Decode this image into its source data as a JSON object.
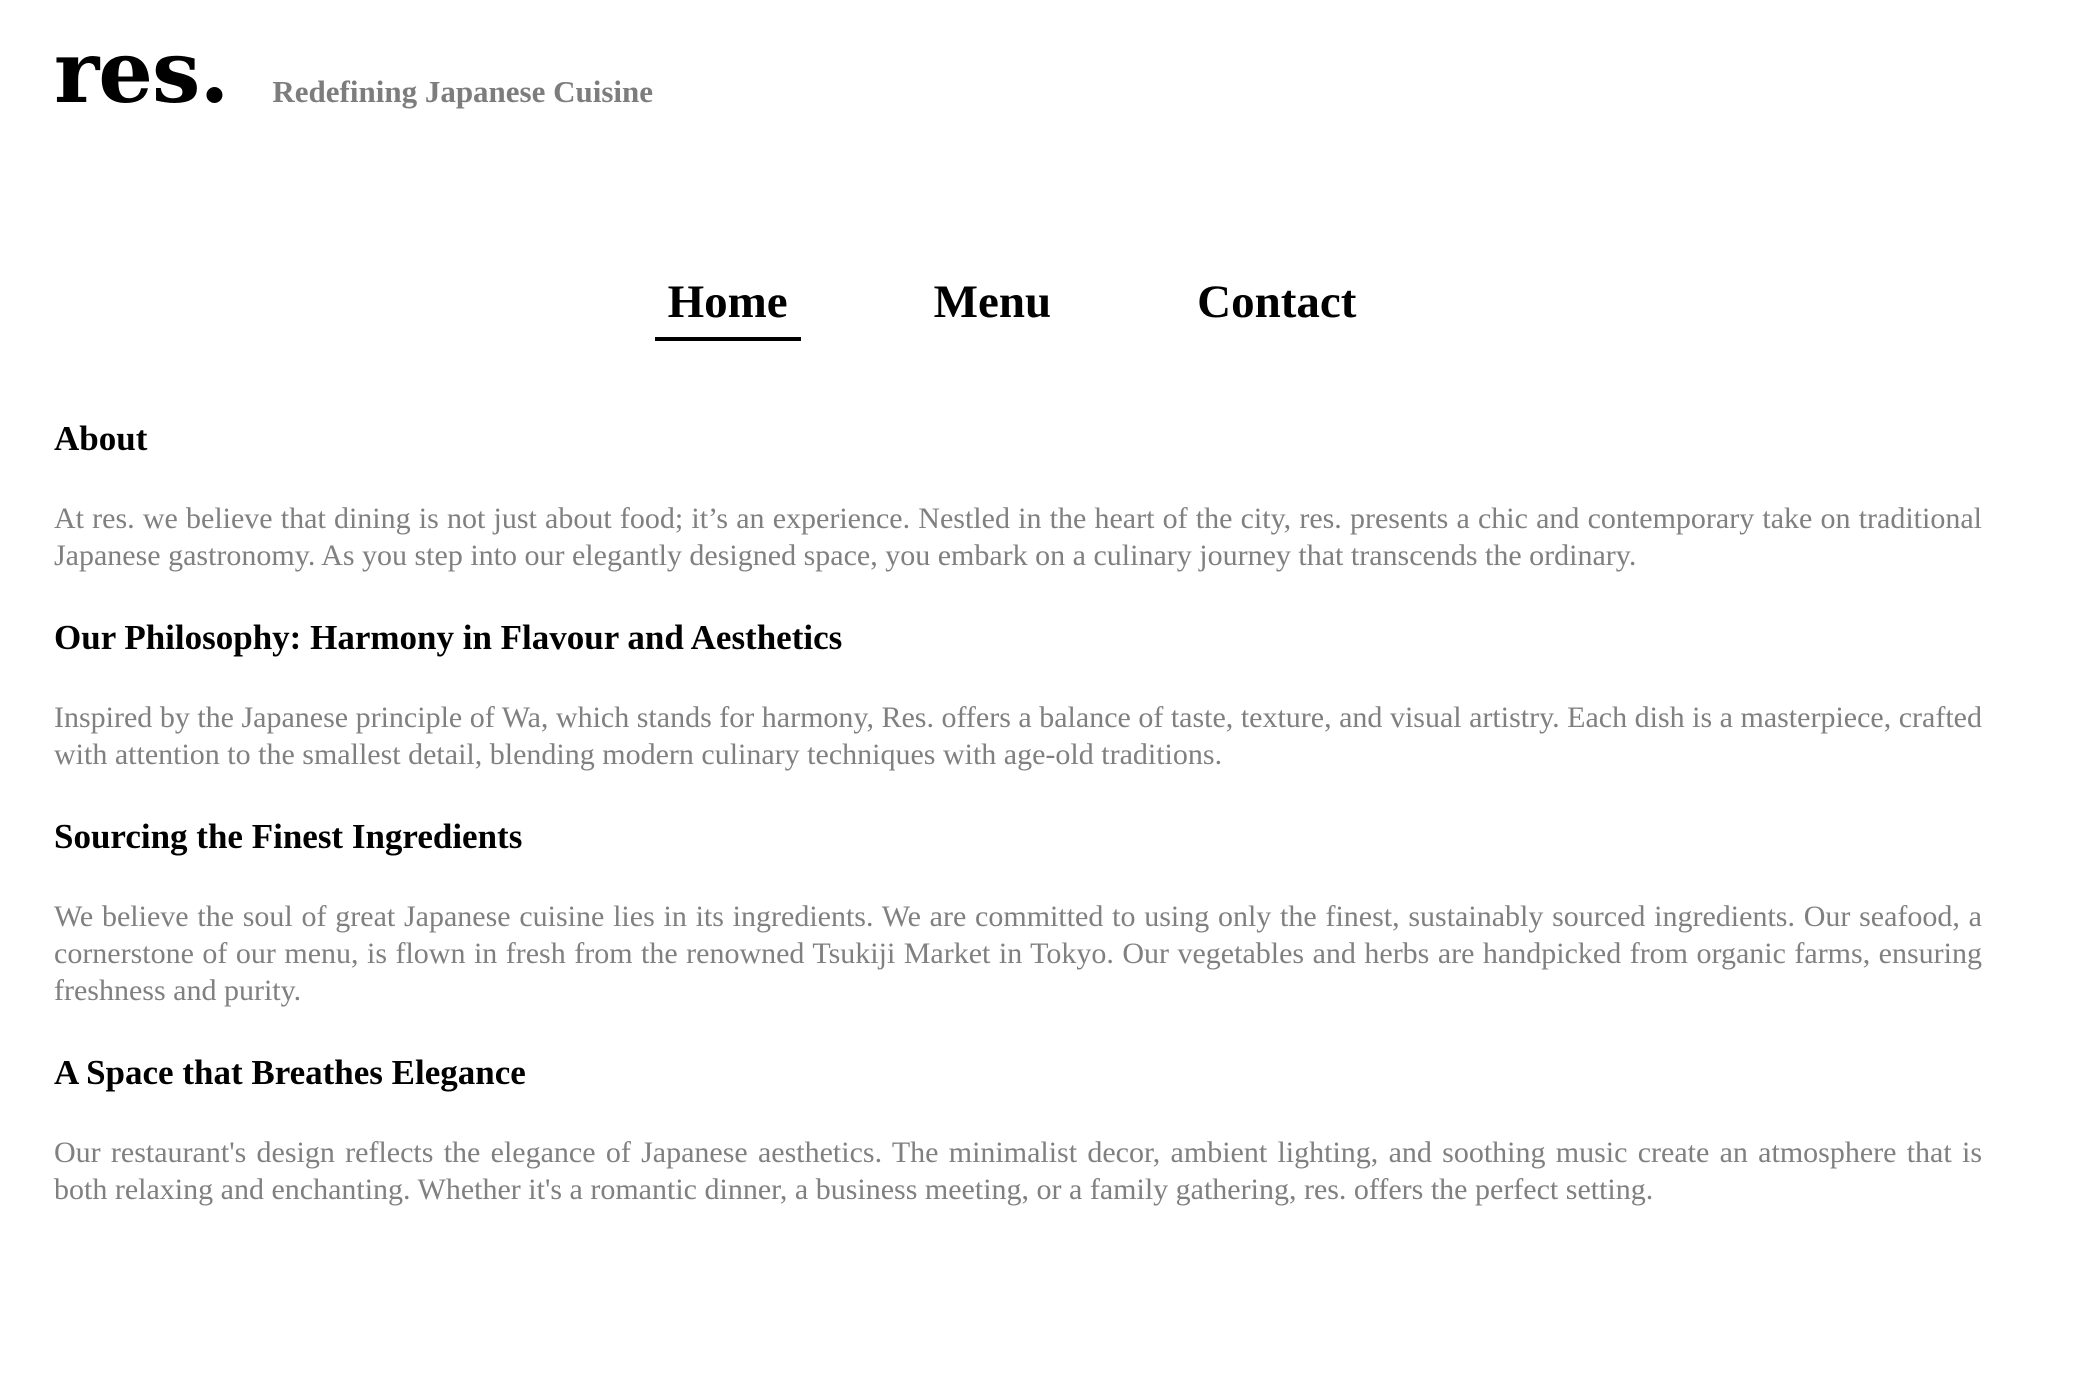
{
  "header": {
    "logo": "res.",
    "tagline": "Redefining Japanese Cuisine"
  },
  "nav": {
    "items": [
      {
        "label": "Home",
        "active": true
      },
      {
        "label": "Menu",
        "active": false
      },
      {
        "label": "Contact",
        "active": false
      }
    ]
  },
  "sections": [
    {
      "heading": "About",
      "body": "At res. we believe that dining is not just about food; it’s an experience. Nestled in the heart of the city, res. presents a chic and contemporary take on traditional Japanese gastronomy. As you step into our elegantly designed space, you embark on a culinary journey that transcends the ordinary."
    },
    {
      "heading": "Our Philosophy: Harmony in Flavour and Aesthetics",
      "body": "Inspired by the Japanese principle of Wa, which stands for harmony, Res. offers a balance of taste, texture, and visual artistry. Each dish is a masterpiece, crafted with attention to the smallest detail, blending modern culinary techniques with age-old traditions."
    },
    {
      "heading": "Sourcing the Finest Ingredients",
      "body": "We believe the soul of great Japanese cuisine lies in its ingredients. We are committed to using only the finest, sustainably sourced ingredients. Our seafood, a cornerstone of our menu, is flown in fresh from the renowned Tsukiji Market in Tokyo. Our vegetables and herbs are handpicked from organic farms, ensuring freshness and purity."
    },
    {
      "heading": "A Space that Breathes Elegance",
      "body": "Our restaurant's design reflects the elegance of Japanese aesthetics. The minimalist decor, ambient lighting, and soothing music create an atmosphere that is both relaxing and enchanting. Whether it's a romantic dinner, a business meeting, or a family gathering, res. offers the perfect setting."
    }
  ],
  "colors": {
    "text": "#000000",
    "muted": "#808080",
    "background": "#ffffff"
  }
}
